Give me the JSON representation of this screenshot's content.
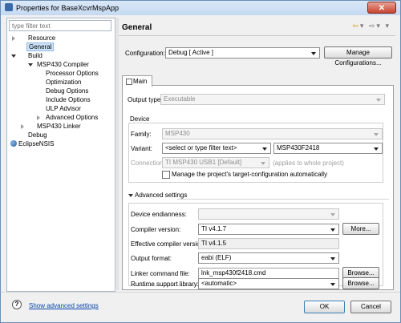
{
  "window": {
    "title": "Properties for BaseXcvrMspApp",
    "close_label": "✕"
  },
  "filter": {
    "placeholder": "type filter text"
  },
  "tree": {
    "resource": "Resource",
    "general": "General",
    "build": "Build",
    "msp430_compiler": "MSP430 Compiler",
    "processor_options": "Processor Options",
    "optimization": "Optimization",
    "debug_options": "Debug Options",
    "include_options": "Include Options",
    "ulp_advisor": "ULP Advisor",
    "advanced_options": "Advanced Options",
    "msp430_linker": "MSP430 Linker",
    "debug": "Debug",
    "eclipse_nsis": "EclipseNSIS"
  },
  "header": {
    "title": "General",
    "nav_back": "⇦",
    "nav_forward": "⇨"
  },
  "configuration": {
    "label": "Configuration:",
    "value": "Debug  [ Active ]",
    "manage_button": "Manage Configurations..."
  },
  "tabs": {
    "main": "Main"
  },
  "output": {
    "label": "Output type:",
    "value": "Executable"
  },
  "device": {
    "group_label": "Device",
    "family_label": "Family:",
    "family_value": "MSP430",
    "variant_label": "Variant:",
    "variant_filter": "<select or type filter text>",
    "variant_value": "MSP430F2418",
    "connection_label": "Connection:",
    "connection_value": "TI MSP430 USB1 [Default]",
    "connection_note": "(applies to whole project)",
    "manage_target_label": "Manage the project's target-configuration automatically"
  },
  "advanced": {
    "section_label": "Advanced settings",
    "endianness_label": "Device endianness:",
    "endianness_value": "",
    "compiler_label": "Compiler version:",
    "compiler_value": "TI v4.1.7",
    "more_button": "More...",
    "effective_label": "Effective compiler version:",
    "effective_value": "TI v4.1.5",
    "format_label": "Output format:",
    "format_value": "eabi (ELF)",
    "linker_label": "Linker command file:",
    "linker_value": "lnk_msp430f2418.cmd",
    "browse1": "Browse...",
    "runtime_label": "Runtime support library:",
    "runtime_value": "<automatic>",
    "browse2": "Browse..."
  },
  "footer": {
    "help_icon": "?",
    "show_advanced": "Show advanced settings",
    "ok": "OK",
    "cancel": "Cancel"
  }
}
